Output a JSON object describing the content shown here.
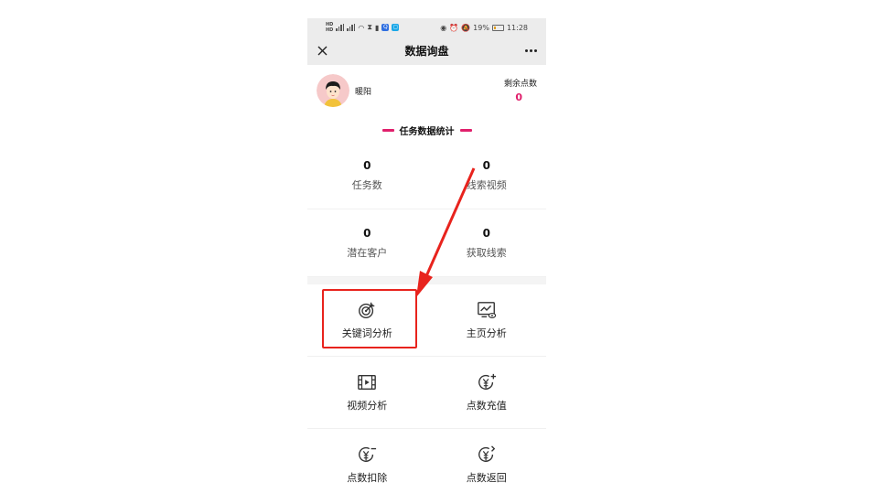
{
  "status_bar": {
    "sim1": "HD",
    "sim2": "HD",
    "network": "4G",
    "battery_percent": "19%",
    "time": "11:28"
  },
  "title_bar": {
    "title": "数据询盘",
    "close_icon": "close-icon",
    "more_icon": "more-icon"
  },
  "user": {
    "name": "暖阳",
    "points_label": "剩余点数",
    "points_value": "0"
  },
  "section": {
    "title": "任务数据统计"
  },
  "stats": [
    {
      "value": "0",
      "label": "任务数"
    },
    {
      "value": "0",
      "label": "线索视频"
    },
    {
      "value": "0",
      "label": "潜在客户"
    },
    {
      "value": "0",
      "label": "获取线索"
    }
  ],
  "functions": [
    {
      "label": "关键词分析",
      "icon": "target-icon"
    },
    {
      "label": "主页分析",
      "icon": "monitor-eye-icon"
    },
    {
      "label": "视频分析",
      "icon": "film-icon"
    },
    {
      "label": "点数充值",
      "icon": "yuan-plus-icon"
    },
    {
      "label": "点数扣除",
      "icon": "yuan-minus-icon"
    },
    {
      "label": "点数返回",
      "icon": "yuan-return-icon"
    }
  ],
  "colors": {
    "accent": "#e0206c",
    "annotation": "#e8231d",
    "title_bar_bg": "#ececec"
  }
}
